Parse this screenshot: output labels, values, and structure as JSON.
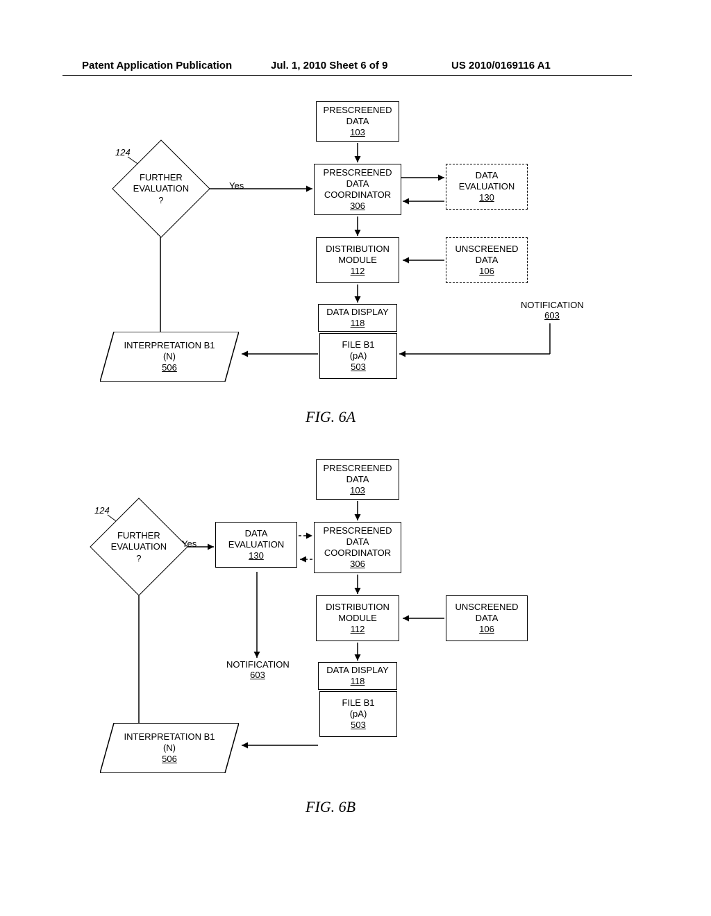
{
  "header": {
    "left": "Patent Application Publication",
    "mid": "Jul. 1, 2010   Sheet 6 of 9",
    "right": "US 2010/0169116 A1"
  },
  "fig6a": {
    "caption": "FIG. 6A",
    "ref124": "124",
    "further_eval": {
      "l1": "FURTHER",
      "l2": "EVALUATION",
      "l3": "?"
    },
    "yes": "Yes",
    "prescr_data": {
      "l1": "PRESCREENED",
      "l2": "DATA",
      "ref": "103"
    },
    "prescr_coord": {
      "l1": "PRESCREENED",
      "l2": "DATA",
      "l3": "COORDINATOR",
      "ref": "306"
    },
    "data_eval": {
      "l1": "DATA",
      "l2": "EVALUATION",
      "ref": "130"
    },
    "dist_mod": {
      "l1": "DISTRIBUTION",
      "l2": "MODULE",
      "ref": "112"
    },
    "unscr_data": {
      "l1": "UNSCREENED",
      "l2": "DATA",
      "ref": "106"
    },
    "notification": {
      "l1": "NOTIFICATION",
      "ref": "603"
    },
    "data_display": {
      "l1": "DATA DISPLAY",
      "ref": "118"
    },
    "file": {
      "l1": "FILE B1",
      "l2": "(pA)",
      "ref": "503"
    },
    "interp": {
      "l1": "INTERPRETATION B1",
      "l2": "(N)",
      "ref": "506"
    }
  },
  "fig6b": {
    "caption": "FIG. 6B",
    "ref124": "124",
    "further_eval": {
      "l1": "FURTHER",
      "l2": "EVALUATION",
      "l3": "?"
    },
    "yes": "Yes",
    "prescr_data": {
      "l1": "PRESCREENED",
      "l2": "DATA",
      "ref": "103"
    },
    "prescr_coord": {
      "l1": "PRESCREENED",
      "l2": "DATA",
      "l3": "COORDINATOR",
      "ref": "306"
    },
    "data_eval": {
      "l1": "DATA",
      "l2": "EVALUATION",
      "ref": "130"
    },
    "dist_mod": {
      "l1": "DISTRIBUTION",
      "l2": "MODULE",
      "ref": "112"
    },
    "unscr_data": {
      "l1": "UNSCREENED",
      "l2": "DATA",
      "ref": "106"
    },
    "notification": {
      "l1": "NOTIFICATION",
      "ref": "603"
    },
    "data_display": {
      "l1": "DATA DISPLAY",
      "ref": "118"
    },
    "file": {
      "l1": "FILE B1",
      "l2": "(pA)",
      "ref": "503"
    },
    "interp": {
      "l1": "INTERPRETATION B1",
      "l2": "(N)",
      "ref": "506"
    }
  }
}
